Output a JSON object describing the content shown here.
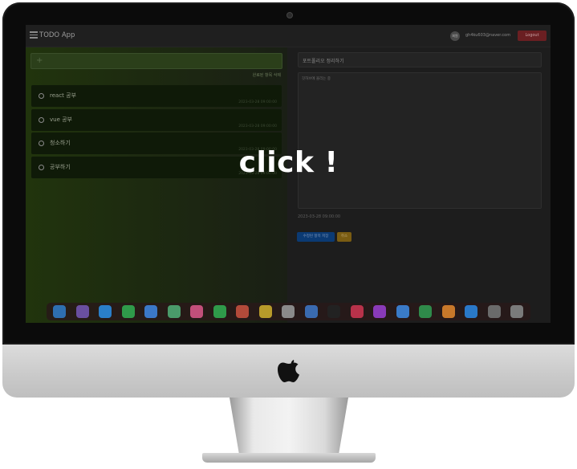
{
  "app": {
    "title": "TODO App",
    "avatar_label": "회원",
    "user_email": "gh4ku603@naver.com",
    "logout_label": "Logout"
  },
  "left_pane": {
    "add_placeholder": "+",
    "clear_done_label": "완료된 항목 삭제",
    "todos": [
      {
        "text": "react 공부",
        "date": "2023-03-28 09:00:00"
      },
      {
        "text": "vue 공부",
        "date": "2023-03-28 09:00:00"
      },
      {
        "text": "청소하기",
        "date": "2023-03-28 09:00:00"
      },
      {
        "text": "공부하기",
        "date": "2023-03-28 09:00:00"
      }
    ]
  },
  "detail": {
    "title": "포트폴리오 정리하기",
    "body": "깃허브에 올리는 중",
    "meta": "2023-03-28 09:00:00",
    "save_label": "수정된 항목 저장",
    "cancel_label": "취소"
  },
  "overlay_text": "click !",
  "dock_icons": [
    "finder-icon",
    "launchpad-icon",
    "safari-icon",
    "messages-icon",
    "mail-icon",
    "maps-icon",
    "photos-icon",
    "facetime-icon",
    "calendar-icon",
    "notes-icon",
    "reminders-icon",
    "freeform-icon",
    "tv-icon",
    "music-icon",
    "podcasts-icon",
    "keynote-icon",
    "numbers-icon",
    "pages-icon",
    "app-store-icon",
    "settings-icon",
    "trash-icon"
  ]
}
